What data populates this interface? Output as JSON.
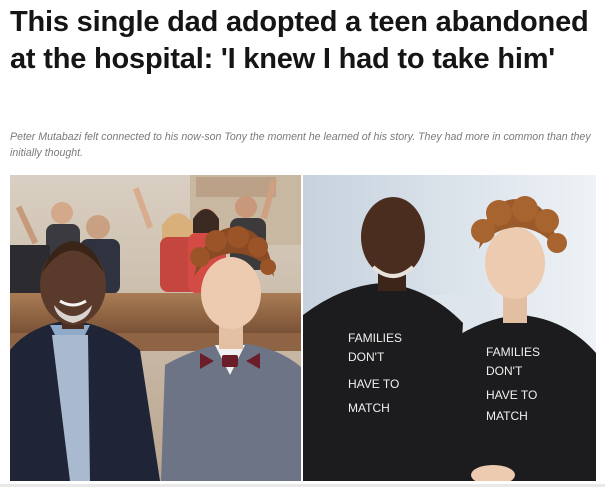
{
  "article": {
    "headline": "This single dad adopted a teen abandoned at the hospital: 'I knew I had to take him'",
    "subtitle": "Peter Mutabazi felt connected to his now-son Tony the moment he learned of his story. They had more in common than they initially thought."
  },
  "photos": {
    "left": {
      "icon": "courtroom-photo"
    },
    "right": {
      "icon": "matching-shirts-photo",
      "shirt_text_lines": [
        "FAMILIES",
        "DON'T",
        "HAVE TO",
        "MATCH"
      ]
    }
  },
  "colors": {
    "headline": "#151515",
    "subtitle": "#7a7a7a",
    "tshirt": "#1c1c1e",
    "bowtie": "#6b1e2a",
    "suit_left": "#1f2536",
    "suit_right": "#6d7485"
  }
}
